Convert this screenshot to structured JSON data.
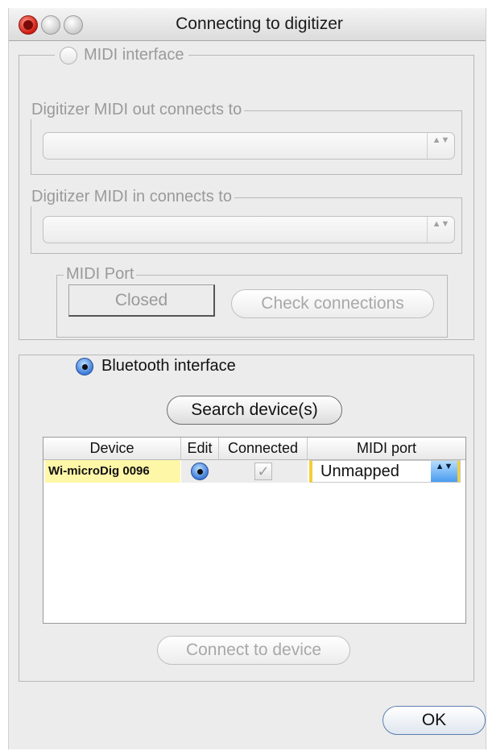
{
  "window": {
    "title": "Connecting to digitizer"
  },
  "midi_section": {
    "radio_label": "MIDI interface",
    "out_label": "Digitizer MIDI out connects to",
    "out_value": "",
    "in_label": "Digitizer MIDI in connects to",
    "in_value": "",
    "port_label": "MIDI Port",
    "port_button": "Closed",
    "check_button": "Check connections"
  },
  "bluetooth_section": {
    "radio_label": "Bluetooth interface",
    "search_button": "Search device(s)",
    "table": {
      "columns": [
        "Device",
        "Edit",
        "Connected",
        "MIDI port"
      ],
      "rows": [
        {
          "device": "Wi-microDig 0096",
          "edit": "selected",
          "connected": "✓",
          "midi_port": "Unmapped"
        }
      ]
    },
    "connect_button": "Connect to device"
  },
  "ok_button": "OK",
  "icons": {
    "arrows": "▲▼",
    "check": "✓"
  },
  "colors": {
    "accent": "#3b7bd8",
    "highlight_row": "#fff7a8",
    "close_button": "#d01810"
  }
}
